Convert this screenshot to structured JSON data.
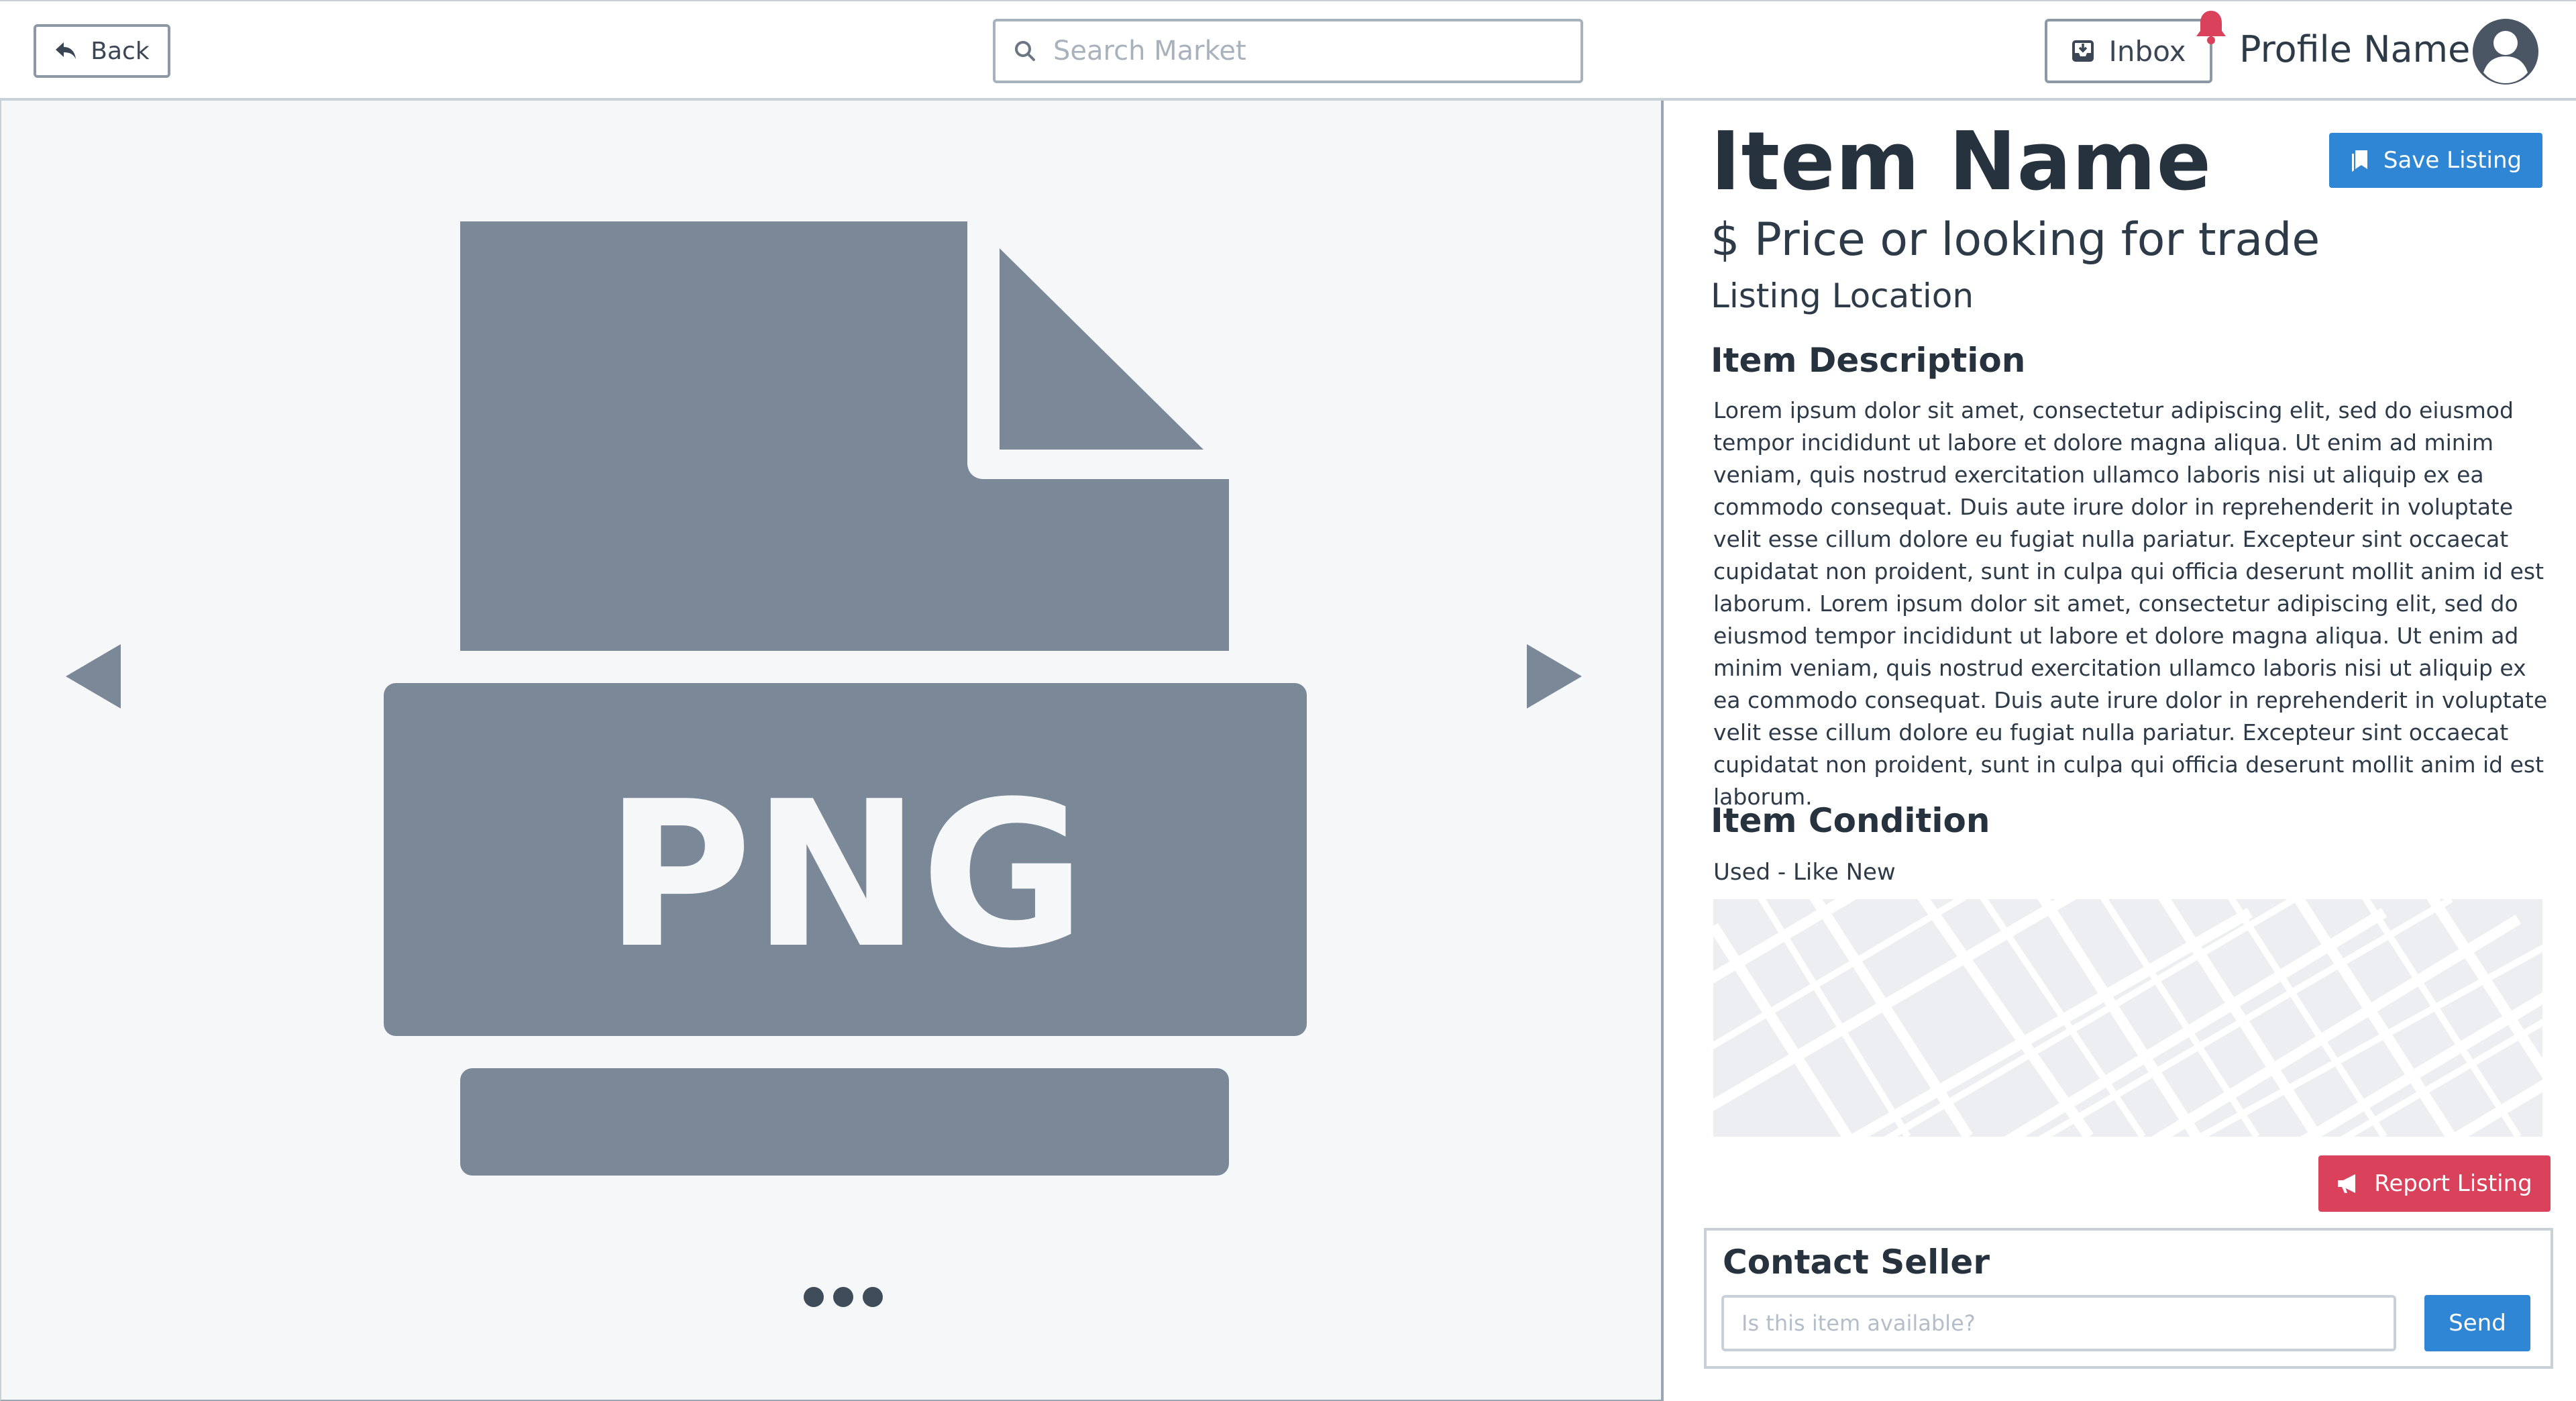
{
  "header": {
    "back_label": "Back",
    "search_placeholder": "Search Market",
    "inbox_label": "Inbox",
    "profile_name": "Profile Name"
  },
  "gallery": {
    "file_type_label": "PNG",
    "icons": [
      "arrow-left-icon",
      "arrow-right-icon",
      "png-file-icon"
    ],
    "page_dots": 3
  },
  "listing": {
    "item_name": "Item Name",
    "save_label": "Save Listing",
    "price": "$ Price or looking for trade",
    "location": "Listing Location",
    "description_title": "Item Description",
    "description": "Lorem ipsum dolor sit amet, consectetur adipiscing elit, sed do eiusmod tempor incididunt ut labore et dolore magna aliqua. Ut enim ad minim veniam, quis nostrud exercitation ullamco laboris nisi ut aliquip ex ea commodo consequat. Duis aute irure dolor in reprehenderit in voluptate velit esse cillum dolore eu fugiat nulla pariatur. Excepteur sint occaecat cupidatat non proident, sunt in culpa qui officia deserunt mollit anim id est laborum. Lorem ipsum dolor sit amet, consectetur adipiscing elit, sed do eiusmod tempor incididunt ut labore et dolore magna aliqua. Ut enim ad minim veniam, quis nostrud exercitation ullamco laboris nisi ut aliquip ex ea commodo consequat. Duis aute irure dolor in reprehenderit in voluptate velit esse cillum dolore eu fugiat nulla pariatur. Excepteur sint occaecat cupidatat non proident, sunt in culpa qui officia deserunt mollit anim id est laborum.",
    "condition_title": "Item Condition",
    "condition": "Used - Like New",
    "report_label": "Report Listing"
  },
  "contact": {
    "title": "Contact Seller",
    "placeholder": "Is this item available?",
    "send_label": "Send"
  },
  "colors": {
    "primary": "#2e86d4",
    "danger": "#d9425a",
    "notification": "#d9425a",
    "placeholder_art": "#7a8898",
    "text_dark": "#26323e"
  }
}
